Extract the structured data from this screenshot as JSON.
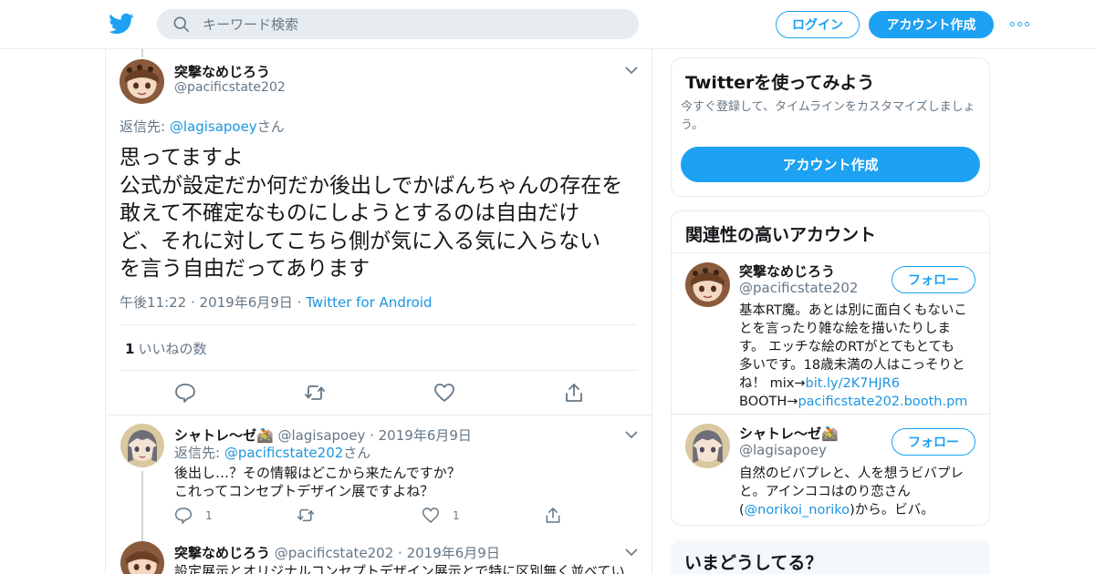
{
  "nav": {
    "search_placeholder": "キーワード検索",
    "login_label": "ログイン",
    "signup_label": "アカウント作成"
  },
  "focus_tweet": {
    "name": "突撃なめじろう",
    "handle": "@pacificstate202",
    "reply_prefix": "返信先: ",
    "reply_handle": "@lagisapoey",
    "reply_suffix": "さん",
    "text_lines": [
      "思ってますよ",
      "公式が設定だか何だか後出しでかばんちゃんの存在を",
      "敢えて不確定なものにしようとするのは自由だけ",
      "ど、それに対してこちら側が気に入る気に入らない",
      "を言う自由だってあります"
    ],
    "time": "午後11:22",
    "date": "2019年6月9日",
    "source": "Twitter for Android",
    "like_count": "1",
    "like_label": "いいねの数"
  },
  "replies": [
    {
      "name": "シャトレ〜ゼ🚵",
      "handle": "@lagisapoey",
      "date": "2019年6月9日",
      "reply_prefix": "返信先: ",
      "reply_handle": "@pacificstate202",
      "reply_suffix": "さん",
      "lines": [
        "後出し…？その情報はどこから来たんですか？",
        "これってコンセプトデザイン展ですよね？"
      ],
      "reply_count": "1",
      "like_count": "1"
    },
    {
      "name": "突撃なめじろう",
      "handle": "@pacificstate202",
      "date": "2019年6月9日",
      "lines": [
        "設定展示とオリジナルコンセプトデザイン展示とで特に区別無く並べてい"
      ]
    }
  ],
  "sidebar": {
    "signup_card": {
      "title": "Twitterを使ってみよう",
      "subtitle_lines": [
        "今すぐ登録して、タイムラインをカスタマイズしましょ",
        "う。"
      ],
      "button_label": "アカウント作成"
    },
    "related": {
      "title": "関連性の高いアカウント",
      "follow_label": "フォロー",
      "accounts": [
        {
          "name": "突撃なめじろう",
          "handle": "@pacificstate202",
          "bio_lines": [
            "基本RT魔。あとは別に面白くもないこ",
            "とを言ったり雑な絵を描いたりしま",
            "す。 エッチな絵のRTがとてもとても",
            "多いです。18歳未満の人はこっそりと"
          ],
          "bio_mix_prefix": "ね！ mix→",
          "bio_mix_link": "bit.ly/2K7HJR6",
          "bio_booth_prefix": "BOOTH→",
          "bio_booth_link": "pacificstate202.booth.pm"
        },
        {
          "name": "シャトレ〜ゼ🚵",
          "handle": "@lagisapoey",
          "bio_lines": [
            "自然のビバプレと、人を想うビバプレ",
            "と。アインココはのり恋さん"
          ],
          "bio_paren_open": "(",
          "bio_link": "@norikoi_noriko",
          "bio_tail": ")から。ビバ。"
        }
      ]
    },
    "trends": {
      "title": "いまどうしてる？"
    }
  },
  "colors": {
    "accent": "#1da1f2",
    "link": "#1b95e0",
    "text": "#14171a",
    "secondary": "#657786",
    "border": "#e6ecf0"
  },
  "icons": [
    "twitter-bird-icon",
    "search-icon",
    "more-icon",
    "chevron-down-icon",
    "reply-icon",
    "retweet-icon",
    "like-icon",
    "share-icon"
  ]
}
